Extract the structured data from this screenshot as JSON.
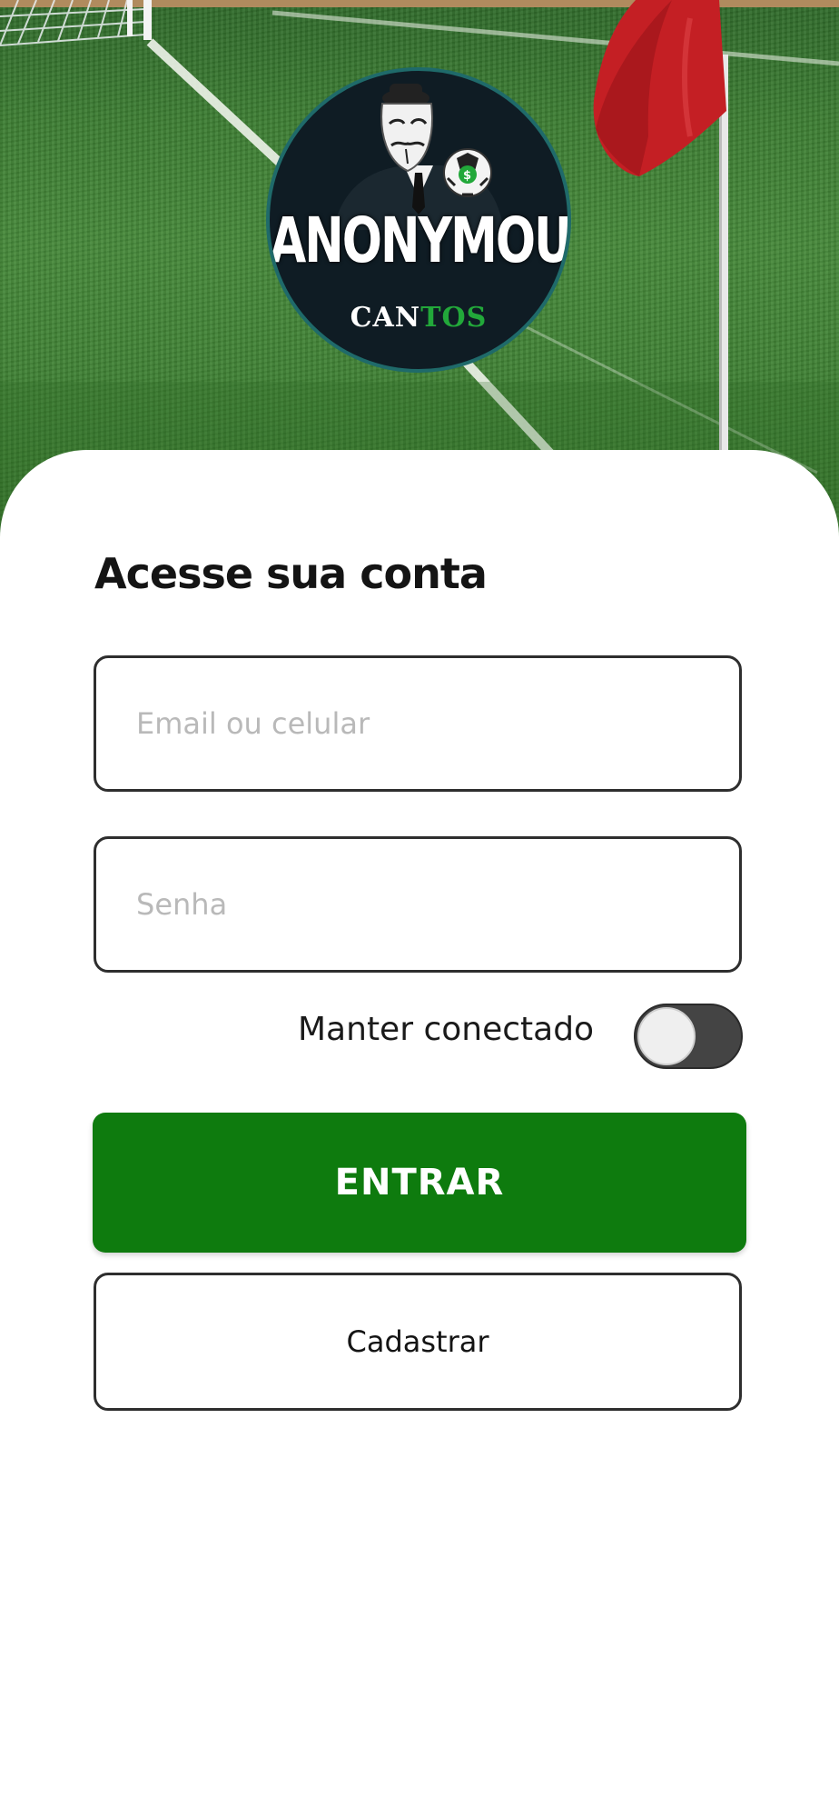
{
  "brand": {
    "logo_title": "ANONYMOUS",
    "logo_sub_white": "CAN",
    "logo_sub_green": "TOS"
  },
  "login": {
    "heading": "Acesse sua conta",
    "email_placeholder": "Email ou celular",
    "email_value": "",
    "password_placeholder": "Senha",
    "password_value": "",
    "keep_connected_label": "Manter conectado",
    "keep_connected_on": false,
    "submit_label": "ENTRAR",
    "register_label": "Cadastrar"
  },
  "colors": {
    "primary": "#0e7b0e",
    "grass": "#3d7e33",
    "flag": "#c41f24",
    "logo_bg": "#0f1c24",
    "logo_accent": "#22a83a"
  }
}
